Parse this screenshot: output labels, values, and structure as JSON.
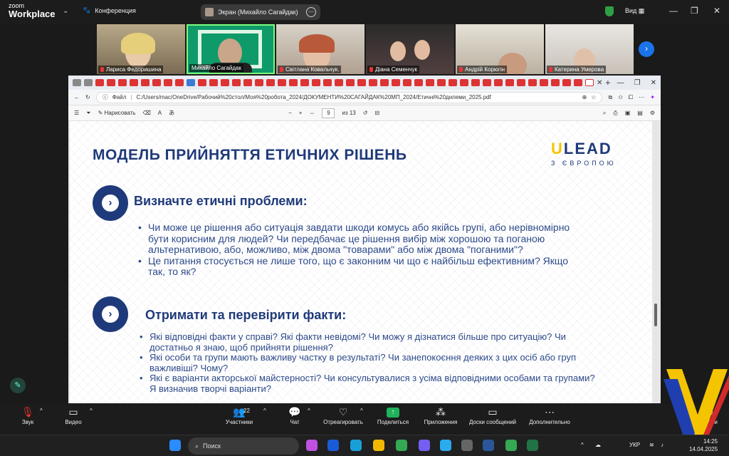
{
  "zoom": {
    "logo_line1": "zoom",
    "logo_line2": "Workplace",
    "meeting_title": "Конференция",
    "screen_label": "Экран (Михайло Сагайдак)",
    "view_label": "Вид"
  },
  "participants": [
    {
      "name": "Лариса Федоришина"
    },
    {
      "name": "Михайло Сагайдак"
    },
    {
      "name": "Світлана Ковальчук."
    },
    {
      "name": "Діана Семенчук"
    },
    {
      "name": "Андрій Корюгін"
    },
    {
      "name": "Катерина Умерова"
    }
  ],
  "browser": {
    "file_label": "Файл",
    "url": "C:/Users/mac/OneDrive/Рабочий%20стол/Моя%20робота_2024/ДОКУМЕНТИ%20САГАЙДАК%20МП_2024/Етичні%20дилеми_2025.pdf",
    "draw_label": "Нарисовать",
    "page_current": "9",
    "page_total": "из 13"
  },
  "slide": {
    "title": "МОДЕЛЬ ПРИЙНЯТТЯ ЕТИЧНИХ РІШЕНЬ",
    "logo_main": "LEAD",
    "logo_u": "U",
    "logo_sub": "З ЄВРОПОЮ",
    "section1_heading": "Визначте етичні проблеми:",
    "section1_bullets": [
      "Чи може це рішення або ситуація завдати шкоди комусь або якійсь групі, або нерівномірно бути корисним для людей? Чи передбачає це рішення вибір між хорошою та поганою альтернативою, або, можливо, між двома \"товарами\" або між двома \"поганими\"?",
      "Це питання стосується не лише того, що є законним чи що є найбільш ефективним? Якщо так, то як?"
    ],
    "section2_heading": "Отримати та перевірити факти:",
    "section2_bullets": [
      "Які відповідні факти у справі? Які факти невідомі? Чи можу я дізнатися більше про ситуацію? Чи достатньо я знаю, щоб прийняти рішення?",
      "Які особи та групи мають важливу частку в результаті? Чи занепокоєння деяких з цих осіб або груп важливіші? Чому?",
      "Які є варіанти акторської майстерності? Чи консультувалися з усіма відповідними особами та групами? Я визначив творчі варіанти?"
    ]
  },
  "toolbar": {
    "audio": "Звук",
    "video": "Видео",
    "participants": "Участники",
    "participants_count": "22",
    "chat": "Чат",
    "react": "Отреагировать",
    "share": "Поделиться",
    "apps": "Приложения",
    "boards": "Доски сообщений",
    "more": "Дополнительно",
    "leave": "Выйти"
  },
  "taskbar": {
    "search_placeholder": "Поиск",
    "lang": "УКР",
    "time": "14:25",
    "date": "14.04.2025"
  },
  "colors": {
    "slide_blue": "#1f3a7a",
    "lead_yellow": "#f5c400",
    "share_green": "#20b15a",
    "next_blue": "#1a73e8"
  }
}
